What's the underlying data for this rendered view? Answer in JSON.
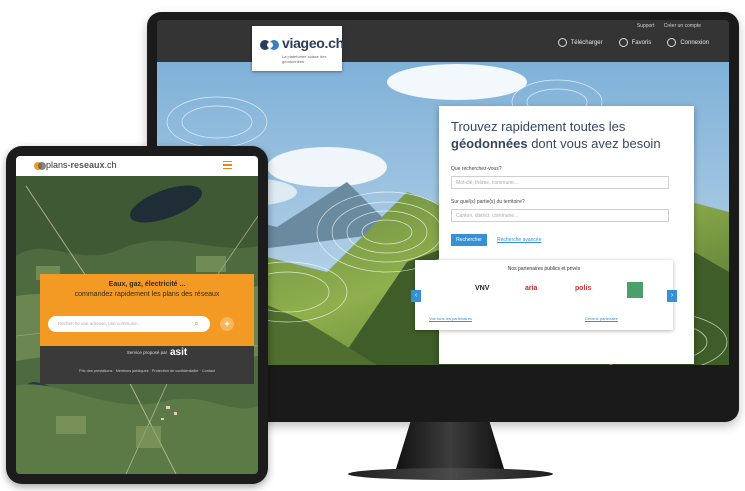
{
  "desktop": {
    "logo": {
      "name": "viageo.ch",
      "tagline": "La plateforme suisse des géodonnées"
    },
    "top_links": [
      "Support",
      "Créer un compte"
    ],
    "nav": [
      {
        "icon": "download-icon",
        "label": "Télécharger"
      },
      {
        "icon": "star-icon",
        "label": "Favoris"
      },
      {
        "icon": "user-icon",
        "label": "Connexion"
      }
    ],
    "search_card": {
      "title_line1": "Trouvez rapidement toutes les",
      "title_bold": "géodonnées",
      "title_rest": " dont vous avez besoin",
      "field1_label": "Que recherchez-vous?",
      "field1_placeholder": "Mot-clé, thème, commune...",
      "field2_label": "Sur quel(s) partie(s) du territoire?",
      "field2_placeholder": "Canton, district, commune...",
      "search_button": "Rechercher",
      "advanced_link": "Recherche avancée"
    },
    "partners": {
      "title": "Nos partenaires publics et privés",
      "logos": [
        "VNV",
        "aria",
        "polis"
      ],
      "links": [
        "Voir tous les partenaires",
        "Devenir partenaire"
      ]
    }
  },
  "tablet": {
    "logo": {
      "prefix": "plans-",
      "bold": "reseaux",
      "suffix": ".ch"
    },
    "headline1": "Eaux, gaz, électricité ...",
    "headline2": "commandez rapidement les plans des réseaux",
    "search_placeholder": "Recherche une adresse, une commune...",
    "powered_by": "Service proposé par",
    "provider": "asit",
    "footer_links": "Prix des prestations · Mentions juridiques · Protection de confidentialité · Contact"
  },
  "colors": {
    "orange": "#f39a25",
    "blue": "#3591d4",
    "dark_header": "#343434",
    "title_blue": "#34485f"
  }
}
